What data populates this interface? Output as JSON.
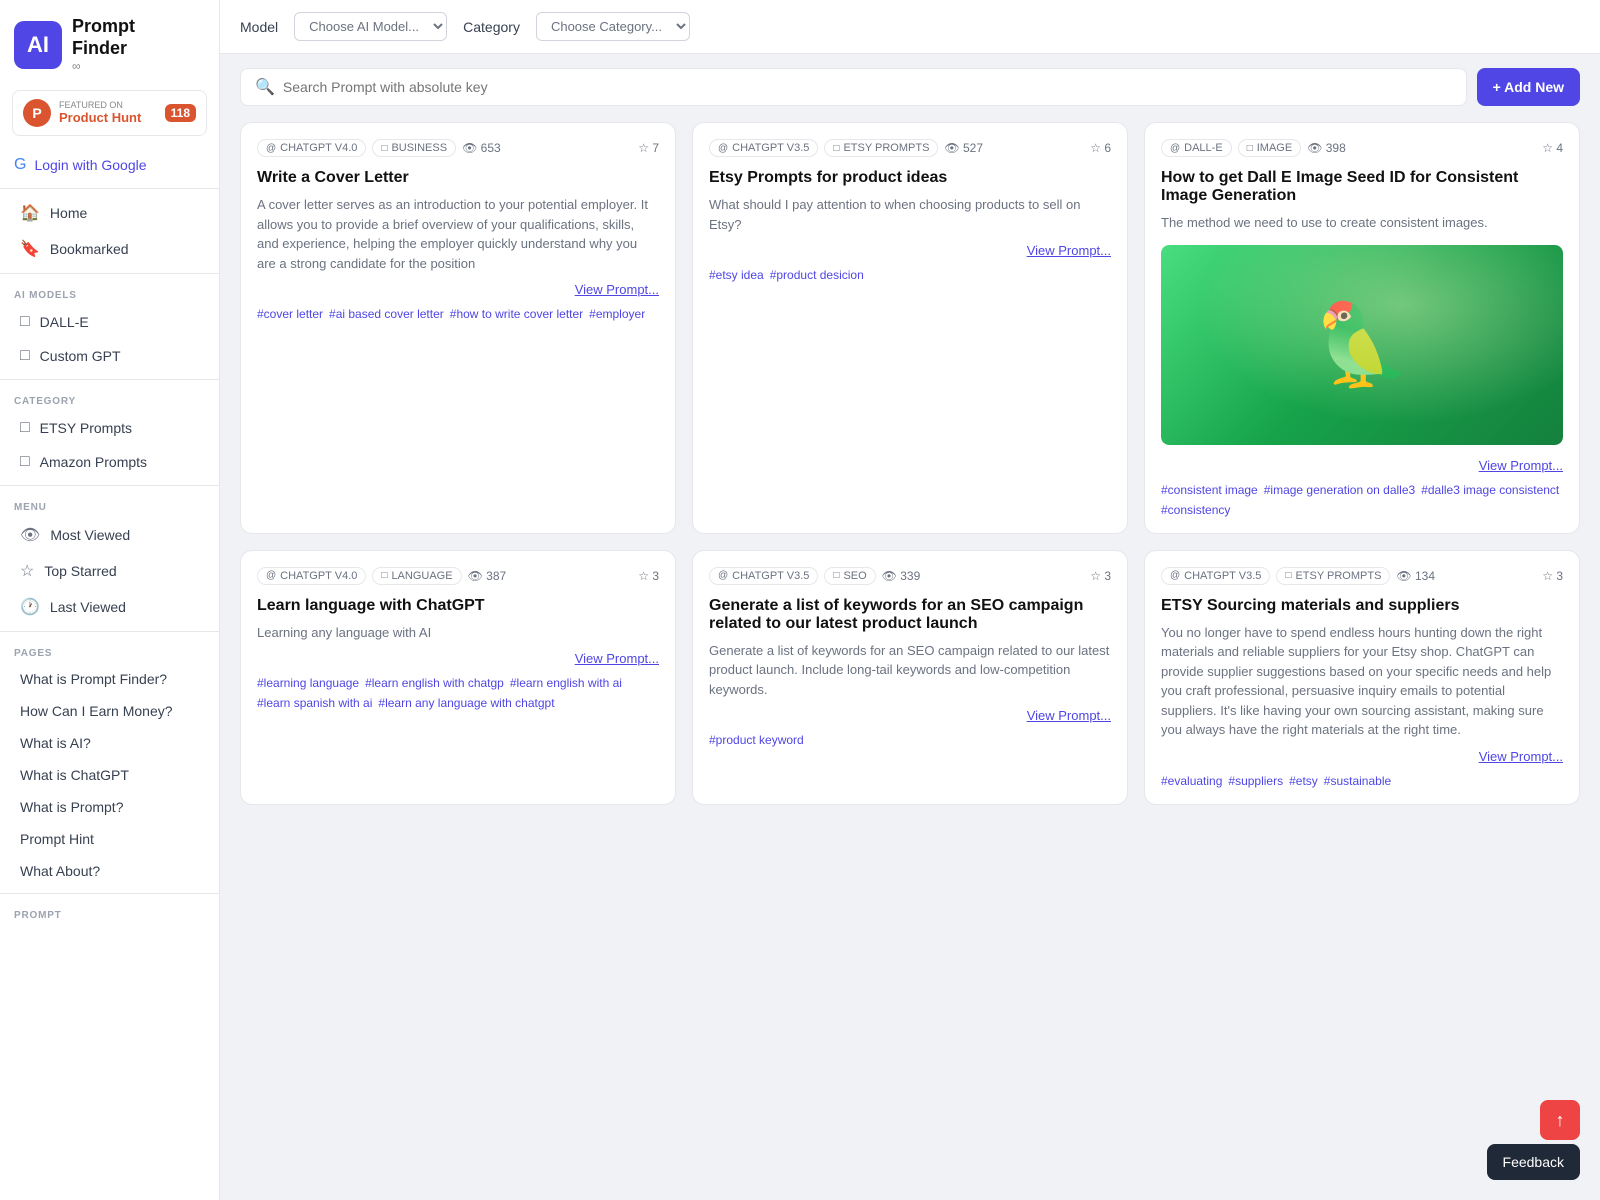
{
  "sidebar": {
    "logo": {
      "icon": "AI",
      "title_top": "Prompt",
      "title_bottom": "Finder",
      "infinity": "∞"
    },
    "product_hunt": {
      "featured_label": "FEATURED ON",
      "name": "Product Hunt",
      "count": "118",
      "icon": "P"
    },
    "login": {
      "label": "Login with Google",
      "icon": "G"
    },
    "nav": [
      {
        "id": "home",
        "label": "Home",
        "icon": "🏠"
      },
      {
        "id": "bookmarked",
        "label": "Bookmarked",
        "icon": "🔖"
      }
    ],
    "ai_models_label": "AI MODELS",
    "ai_models": [
      {
        "id": "dall-e",
        "label": "DALL-E",
        "icon": "□"
      },
      {
        "id": "custom-gpt",
        "label": "Custom GPT",
        "icon": "□"
      }
    ],
    "category_label": "CATEGORY",
    "categories": [
      {
        "id": "etsy-prompts",
        "label": "ETSY Prompts",
        "icon": "□"
      },
      {
        "id": "amazon-prompts",
        "label": "Amazon Prompts",
        "icon": "□"
      }
    ],
    "menu_label": "MENU",
    "menu": [
      {
        "id": "most-viewed",
        "label": "Most Viewed",
        "icon": "👁"
      },
      {
        "id": "top-starred",
        "label": "Top Starred",
        "icon": "☆"
      },
      {
        "id": "last-viewed",
        "label": "Last Viewed",
        "icon": "🕐"
      }
    ],
    "pages_label": "PAGES",
    "pages": [
      {
        "id": "what-is-prompt-finder",
        "label": "What is Prompt Finder?"
      },
      {
        "id": "how-earn-money",
        "label": "How Can I Earn Money?"
      },
      {
        "id": "what-is-ai",
        "label": "What is AI?"
      },
      {
        "id": "what-is-chatgpt",
        "label": "What is ChatGPT"
      },
      {
        "id": "what-is-prompt",
        "label": "What is Prompt?"
      },
      {
        "id": "prompt-hint",
        "label": "Prompt Hint"
      },
      {
        "id": "what-about",
        "label": "What About?"
      }
    ],
    "prompt_label": "Prompt"
  },
  "topbar": {
    "model_label": "Model",
    "model_placeholder": "Choose AI Model...",
    "category_label": "Category",
    "category_placeholder": "Choose Category..."
  },
  "search": {
    "placeholder": "Search Prompt with absolute key",
    "add_new": "+ Add New"
  },
  "cards": [
    {
      "id": "card1",
      "model": "CHATGPT V4.0",
      "category": "BUSINESS",
      "views": "653",
      "stars": "7",
      "title": "Write a Cover Letter",
      "description": "A cover letter serves as an introduction to your potential employer. It allows you to provide a brief overview of your qualifications, skills, and experience, helping the employer quickly understand why you are a strong candidate for the position",
      "view_link": "View Prompt...",
      "hashtags": [
        "#cover letter",
        "#ai based cover letter",
        "#how to write cover letter",
        "#employer"
      ],
      "image": null
    },
    {
      "id": "card2",
      "model": "CHATGPT V3.5",
      "category": "ETSY PROMPTS",
      "views": "527",
      "stars": "6",
      "title": "Etsy Prompts for product ideas",
      "description": "What should I pay attention to when choosing products to sell on Etsy?",
      "view_link": "View Prompt...",
      "hashtags": [
        "#etsy idea",
        "#product desicion"
      ],
      "image": null
    },
    {
      "id": "card3",
      "model": "DALL-E",
      "category": "IMAGE",
      "views": "398",
      "stars": "4",
      "title": "How to get Dall E Image Seed ID for Consistent Image Generation",
      "description": "The method we need to use to create consistent images.",
      "view_link": "View Prompt...",
      "hashtags": [
        "#consistent image",
        "#image generation on dalle3",
        "#dalle3 image consistenct",
        "#consistency"
      ],
      "image": "parrot"
    },
    {
      "id": "card4",
      "model": "CHATGPT V4.0",
      "category": "LANGUAGE",
      "views": "387",
      "stars": "3",
      "title": "Learn language with ChatGPT",
      "description": "Learning any language with AI",
      "view_link": "View Prompt...",
      "hashtags": [
        "#learning language",
        "#learn english with chatgp",
        "#learn english with ai",
        "#learn spanish with ai",
        "#learn any language with chatgpt"
      ],
      "image": null
    },
    {
      "id": "card5",
      "model": "CHATGPT V3.5",
      "category": "SEO",
      "views": "339",
      "stars": "3",
      "title": "Generate a list of keywords for an SEO campaign related to our latest product launch",
      "description": "Generate a list of keywords for an SEO campaign related to our latest product launch. Include long-tail keywords and low-competition keywords.",
      "view_link": "View Prompt...",
      "hashtags": [
        "#product keyword"
      ],
      "image": null
    },
    {
      "id": "card6",
      "model": "CHATGPT V3.5",
      "category": "ETSY PROMPTS",
      "views": "134",
      "stars": "3",
      "title": "ETSY Sourcing materials and suppliers",
      "description": "You no longer have to spend endless hours hunting down the right materials and reliable suppliers for your Etsy shop. ChatGPT can provide supplier suggestions based on your specific needs and help you craft professional, persuasive inquiry emails to potential suppliers. It's like having your own sourcing assistant, making sure you always have the right materials at the right time.",
      "view_link": "View Prompt...",
      "hashtags": [
        "#evaluating",
        "#suppliers",
        "#etsy",
        "#sustainable"
      ],
      "image": null
    }
  ],
  "feedback": {
    "label": "Feedback"
  },
  "scroll_top": "↑"
}
